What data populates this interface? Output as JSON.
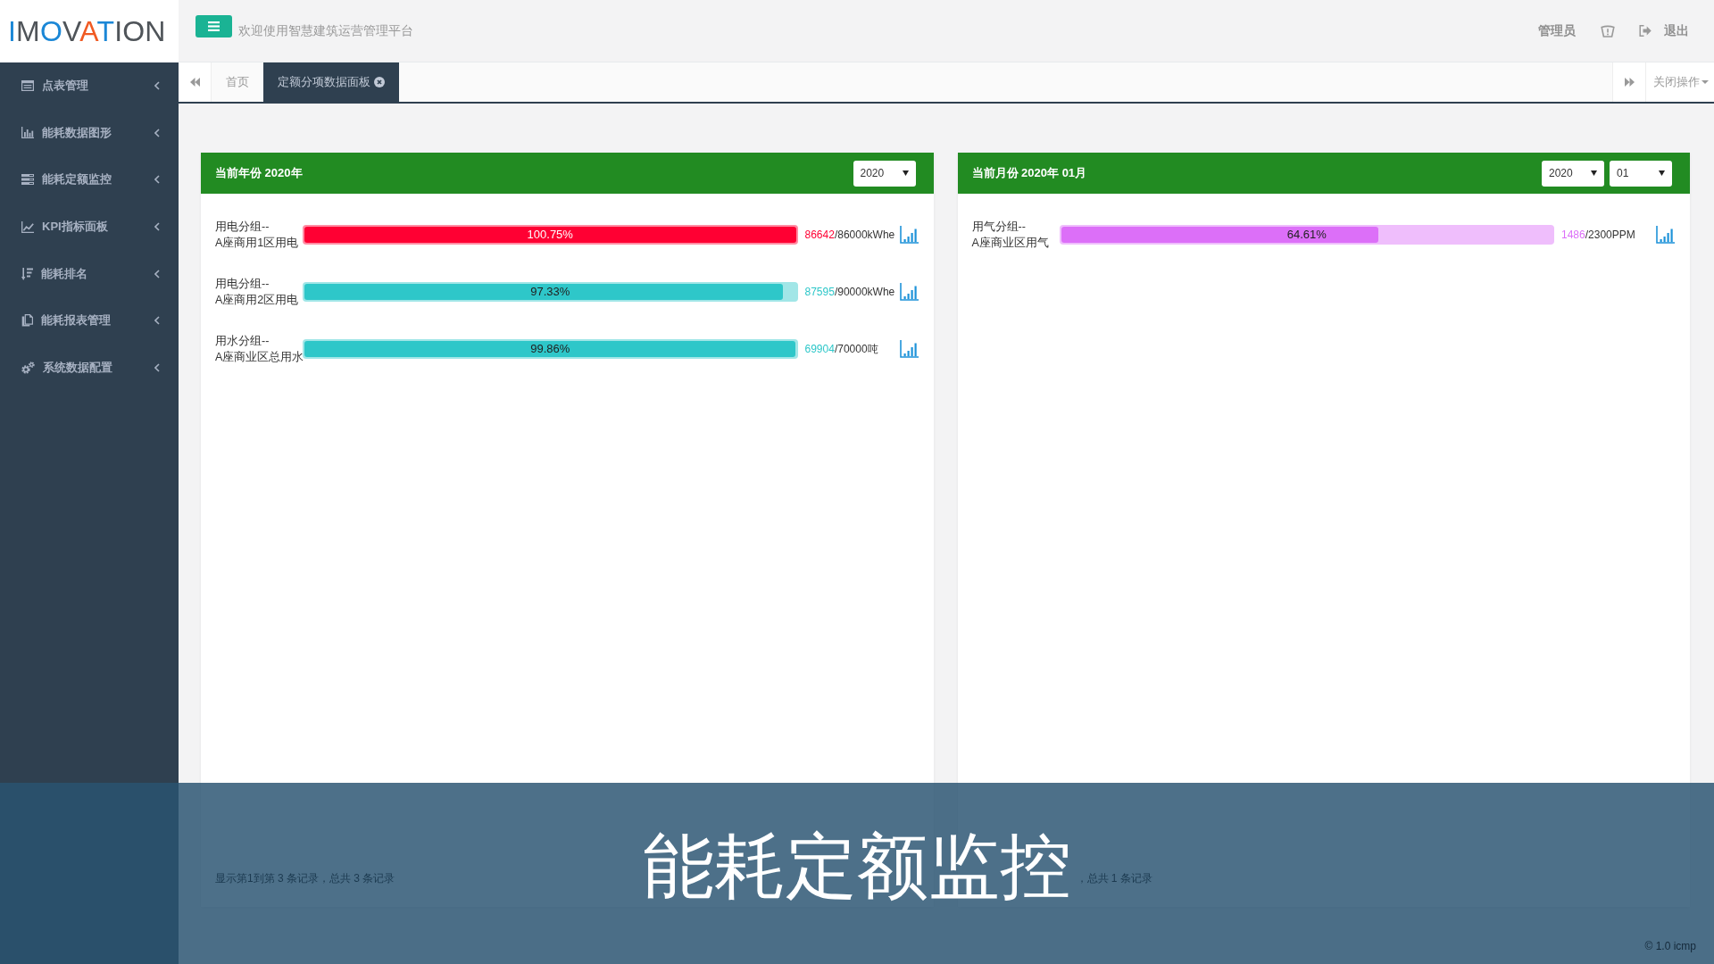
{
  "logo": {
    "parts": [
      {
        "text": "I",
        "color": "#1b87d6"
      },
      {
        "text": "M",
        "color": "#4f5459"
      },
      {
        "text": "O",
        "color": "#1b87d6"
      },
      {
        "text": "V",
        "color": "#4f5459"
      },
      {
        "text": "A",
        "color": "#f05a23"
      },
      {
        "text": "T",
        "color": "#1b87d6"
      },
      {
        "text": "ION",
        "color": "#4f5459"
      }
    ]
  },
  "sidebar": {
    "items": [
      {
        "label": "点表管理",
        "expanded": false
      },
      {
        "label": "能耗数据图形",
        "expanded": false
      },
      {
        "label": "能耗定额监控",
        "expanded": false
      },
      {
        "label": "KPI指标面板",
        "expanded": false
      },
      {
        "label": "能耗排名",
        "expanded": false
      },
      {
        "label": "能耗报表管理",
        "expanded": false
      },
      {
        "label": "系统数据配置",
        "expanded": false
      }
    ]
  },
  "header": {
    "welcome": "欢迎使用智慧建筑运营管理平台",
    "user": "管理员",
    "logout": "退出"
  },
  "tabs": {
    "items": [
      {
        "label": "首页",
        "selected": false,
        "closable": false
      },
      {
        "label": "定额分项数据面板",
        "selected": true,
        "closable": true
      }
    ],
    "close_menu": "关闭操作"
  },
  "panels": [
    {
      "title": "当前年份 2020年",
      "selects": [
        "2020"
      ],
      "rows": [
        {
          "group": "用电分组--",
          "name": "A座商用1区用电",
          "percent": "100.75%",
          "level": 1,
          "color": "#ff0033",
          "over": true,
          "used": "86642",
          "quota": "/86000kWhe"
        },
        {
          "group": "用电分组--",
          "name": "A座商用2区用电",
          "percent": "97.33%",
          "level": 0.9733,
          "color": "#2ec7c9",
          "over": false,
          "used": "87595",
          "quota": "/90000kWhe"
        },
        {
          "group": "用水分组--",
          "name": "A座商业区总用水",
          "percent": "99.86%",
          "level": 0.9986,
          "color": "#2ec7c9",
          "over": false,
          "used": "69904",
          "quota": "/70000吨"
        }
      ],
      "footer": "显示第1到第 3 条记录，总共 3 条记录"
    },
    {
      "title": "当前月份 2020年 01月",
      "selects": [
        "2020",
        "01"
      ],
      "rows": [
        {
          "group": "用气分组--",
          "name": "A座商业区用气",
          "percent": "64.61%",
          "level": 0.6461,
          "color": "#dc6ff8",
          "over": false,
          "used": "1486",
          "quota": "/2300PPM"
        }
      ],
      "footer": "，总共 1 条记录"
    }
  ],
  "caption": "能耗定额监控",
  "copyright": "© 1.0 icmp"
}
